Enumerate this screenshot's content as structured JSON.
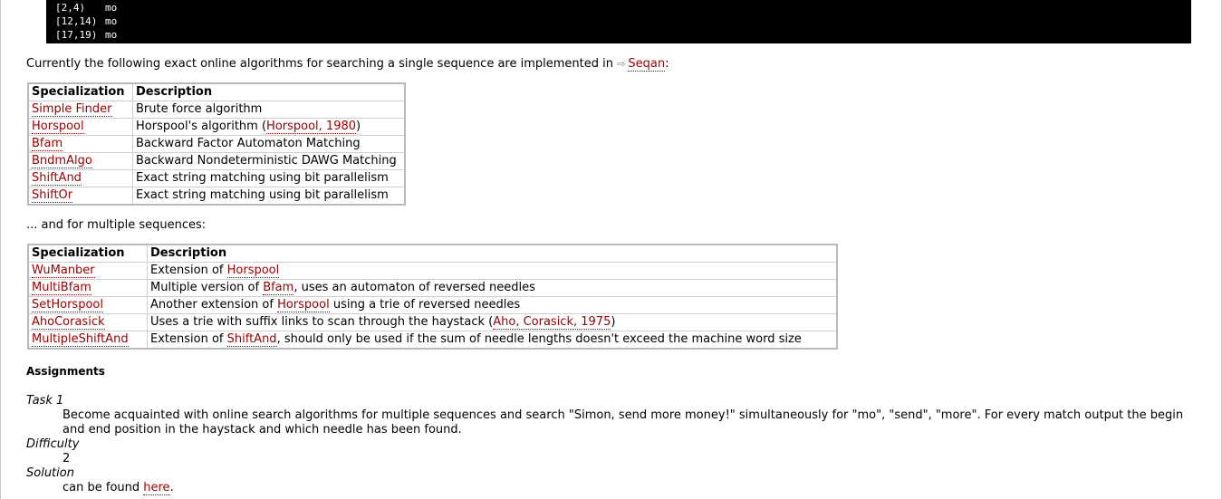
{
  "code": {
    "lines": [
      {
        "range": "[2,4)",
        "value": "mo"
      },
      {
        "range": "[12,14)",
        "value": "mo"
      },
      {
        "range": "[17,19)",
        "value": "mo"
      }
    ]
  },
  "intro": {
    "text": "Currently the following exact online algorithms for searching a single sequence are implemented in",
    "link": "Seqan",
    "suffix": ":"
  },
  "single_table": {
    "headers": [
      "Specialization",
      "Description"
    ],
    "rows": [
      {
        "name": "Simple Finder",
        "desc": "Brute force algorithm"
      },
      {
        "name": "Horspool",
        "desc_pre": "Horspool's algorithm (",
        "desc_link": "Horspool, 1980",
        "desc_post": ")"
      },
      {
        "name": "Bfam",
        "desc": "Backward Factor Automaton Matching"
      },
      {
        "name": "BndmAlgo",
        "desc": "Backward Nondeterministic DAWG Matching"
      },
      {
        "name": "ShiftAnd",
        "desc": "Exact string matching using bit parallelism"
      },
      {
        "name": "ShiftOr",
        "desc": "Exact string matching using bit parallelism"
      }
    ]
  },
  "intro2": "... and for multiple sequences:",
  "multi_table": {
    "headers": [
      "Specialization",
      "Description"
    ],
    "rows": [
      {
        "name": "WuManber",
        "desc_pre": "Extension of ",
        "desc_link": "Horspool",
        "desc_post": ""
      },
      {
        "name": "MultiBfam",
        "desc_pre": "Multiple version of ",
        "desc_link": "Bfam",
        "desc_post": ", uses an automaton of reversed needles"
      },
      {
        "name": "SetHorspool",
        "desc_pre": "Another extension of ",
        "desc_link": "Horspool",
        "desc_post": " using a trie of reversed needles"
      },
      {
        "name": "AhoCorasick",
        "desc_pre": "Uses a trie with suffix links to scan through the haystack (",
        "desc_link": "Aho, Corasick, 1975",
        "desc_post": ")"
      },
      {
        "name": "MultipleShiftAnd",
        "desc_pre": "Extension of ",
        "desc_link": "ShiftAnd",
        "desc_post": ", should only be used if the sum of needle lengths doesn't exceed the machine word size"
      }
    ]
  },
  "assignments": {
    "heading": "Assignments",
    "task_label": "Task 1",
    "task_text": "Become acquainted with online search algorithms for multiple sequences and search \"Simon, send more money!\" simultaneously for \"mo\", \"send\", \"more\". For every match output the begin and end position in the haystack and which needle has been found.",
    "difficulty_label": "Difficulty",
    "difficulty_value": "2",
    "solution_label": "Solution",
    "solution_pre": "can be found ",
    "solution_link": "here",
    "solution_post": "."
  },
  "colors": {
    "link": "#990000",
    "code_bg": "#000000"
  }
}
